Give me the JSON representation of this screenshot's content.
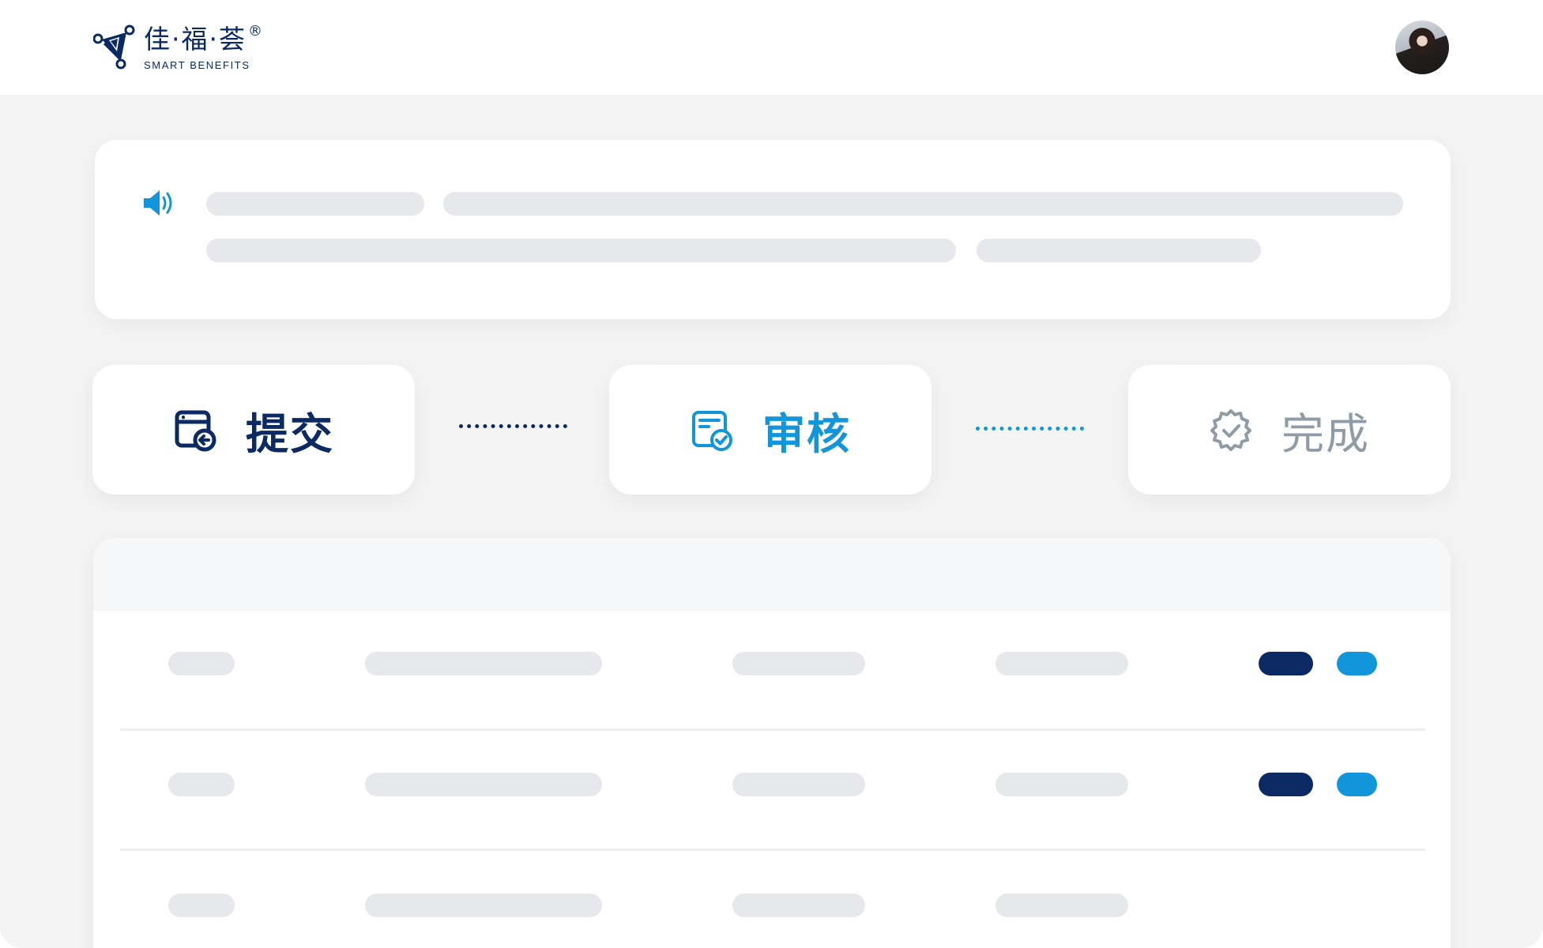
{
  "header": {
    "logo": {
      "cn": "佳·福·荟",
      "registered": "®",
      "en": "SMART BENEFITS"
    },
    "avatar_icon": "user-avatar-photo"
  },
  "notice": {
    "icon": "speaker-icon",
    "accent": "#1296db"
  },
  "steps": [
    {
      "label": "提交",
      "icon": "submit-document-icon",
      "color": "#0b2a63",
      "state": "done"
    },
    {
      "label": "审核",
      "icon": "review-document-icon",
      "color": "#1296db",
      "state": "active"
    },
    {
      "label": "完成",
      "icon": "complete-badge-icon",
      "color": "#8f9ba5",
      "state": "pending"
    }
  ],
  "table": {
    "rows": 3,
    "action_colors": [
      "#0b2a63",
      "#1296db"
    ],
    "placeholder_color": "#e6e8eb"
  }
}
